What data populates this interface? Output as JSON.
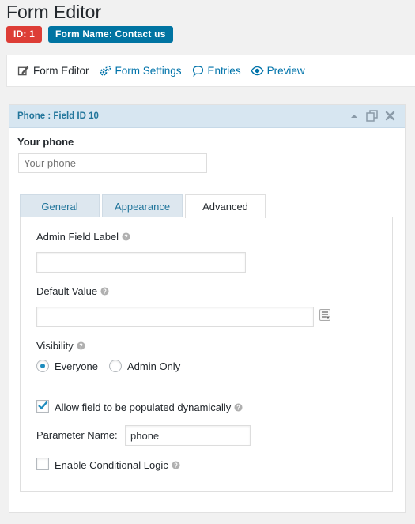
{
  "page": {
    "title": "Form Editor"
  },
  "badges": {
    "id": "ID: 1",
    "form_name": "Form Name: Contact us"
  },
  "toolbar": {
    "items": [
      {
        "label": "Form Editor",
        "icon": "edit-icon"
      },
      {
        "label": "Form Settings",
        "icon": "gear-icon"
      },
      {
        "label": "Entries",
        "icon": "speech-bubble-icon"
      },
      {
        "label": "Preview",
        "icon": "eye-icon"
      }
    ]
  },
  "field": {
    "header": "Phone : Field ID 10",
    "label": "Your phone",
    "placeholder": "Your phone"
  },
  "tabs": [
    "General",
    "Appearance",
    "Advanced"
  ],
  "advanced": {
    "admin_label": {
      "label": "Admin Field Label",
      "value": ""
    },
    "default_value": {
      "label": "Default Value",
      "value": ""
    },
    "visibility": {
      "label": "Visibility",
      "options": [
        "Everyone",
        "Admin Only"
      ],
      "selected": "Everyone"
    },
    "dynamic_populate": {
      "label": "Allow field to be populated dynamically",
      "checked": true
    },
    "parameter_name": {
      "label": "Parameter Name:",
      "value": "phone"
    },
    "conditional_logic": {
      "label": "Enable Conditional Logic",
      "checked": false
    }
  },
  "colors": {
    "accent": "#0073aa",
    "id_badge": "#dd3d36",
    "name_badge": "#0074a2",
    "header_bg": "#d7e6f1"
  }
}
